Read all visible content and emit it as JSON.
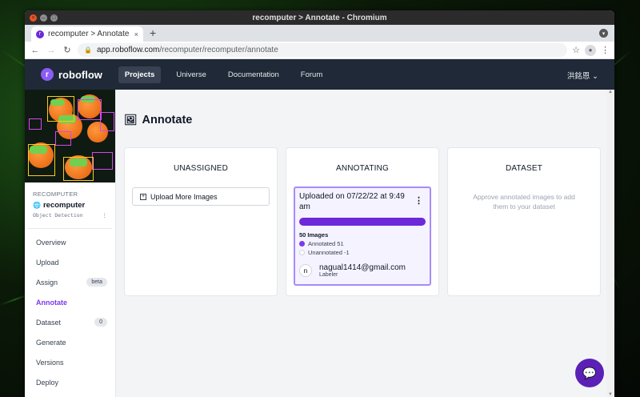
{
  "window": {
    "title": "recomputer > Annotate - Chromium"
  },
  "browser": {
    "tab_title": "recomputer > Annotate",
    "tab_close": "×",
    "new_tab": "+",
    "url_host": "app.roboflow.com",
    "url_path": "/recomputer/recomputer/annotate"
  },
  "app_nav": {
    "logo": "roboflow",
    "links": [
      "Projects",
      "Universe",
      "Documentation",
      "Forum"
    ],
    "active_link": "Projects",
    "user": "洪銘恩"
  },
  "sidebar": {
    "workspace_label": "RECOMPUTER",
    "project_name": "recomputer",
    "project_type": "Object Detection",
    "items": [
      {
        "label": "Overview",
        "badge": ""
      },
      {
        "label": "Upload",
        "badge": ""
      },
      {
        "label": "Assign",
        "badge": "beta"
      },
      {
        "label": "Annotate",
        "badge": ""
      },
      {
        "label": "Dataset",
        "badge": "0"
      },
      {
        "label": "Generate",
        "badge": ""
      },
      {
        "label": "Versions",
        "badge": ""
      },
      {
        "label": "Deploy",
        "badge": ""
      }
    ],
    "active_item": "Annotate"
  },
  "main": {
    "page_title": "Annotate",
    "columns": {
      "unassigned": {
        "title": "UNASSIGNED",
        "upload_button": "Upload More Images"
      },
      "annotating": {
        "title": "ANNOTATING",
        "batch": {
          "title": "Uploaded on 07/22/22 at 9:49 am",
          "progress": 1.0,
          "image_count": "50 Images",
          "annotated": "Annotated 51",
          "unannotated": "Unannotated -1",
          "labeler_initial": "n",
          "labeler_email": "nagual1414@gmail.com",
          "labeler_role": "Labeler"
        }
      },
      "dataset": {
        "title": "DATASET",
        "hint": "Approve annotated images to add them to your dataset"
      }
    }
  },
  "colors": {
    "accent": "#7c3aed",
    "nav_bg": "#1f2937",
    "progress": "#6d28d9"
  }
}
